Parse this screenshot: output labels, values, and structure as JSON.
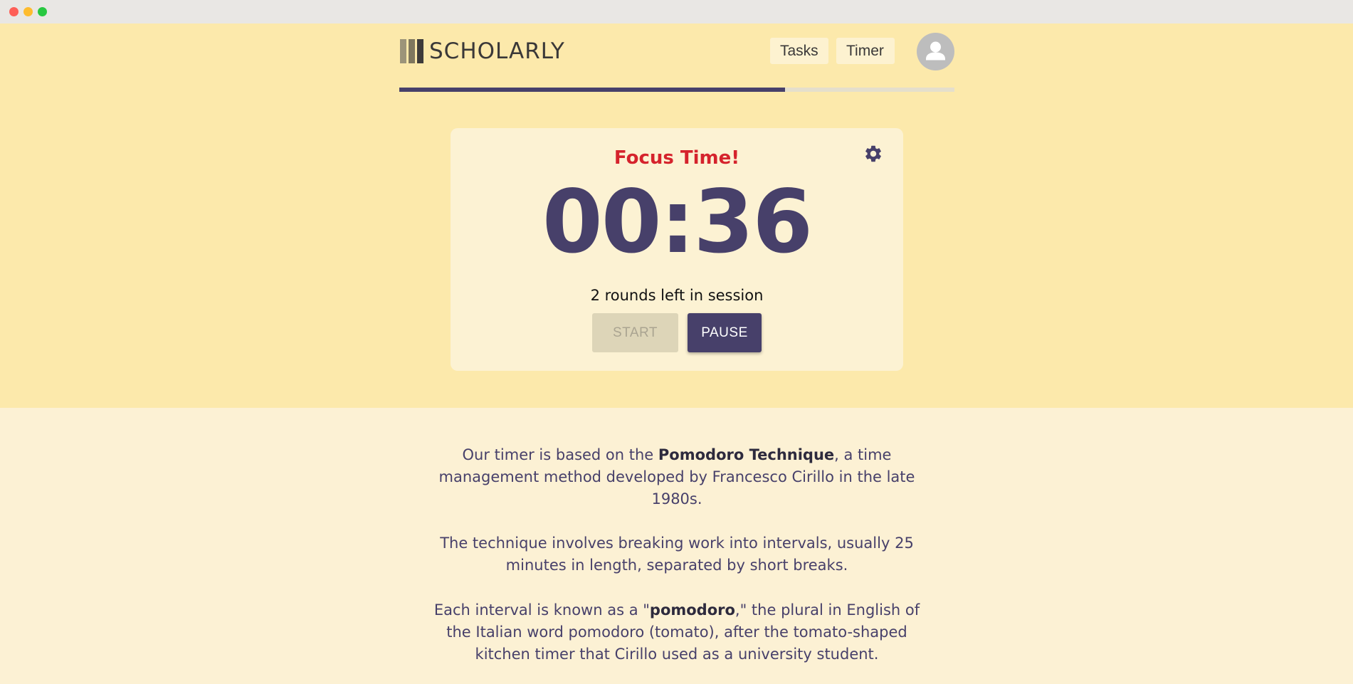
{
  "window": {
    "buttons": [
      "close",
      "minimize",
      "maximize"
    ]
  },
  "header": {
    "logo_text": "SCHOLARLY",
    "nav": {
      "tasks": "Tasks",
      "timer": "Timer"
    },
    "avatar_icon": "user-icon"
  },
  "progress": {
    "fraction": 0.695,
    "color": "#47406a"
  },
  "timer": {
    "status": "Focus Time!",
    "time": "00:36",
    "rounds_left": "2 rounds left in session",
    "start_label": "START",
    "pause_label": "PAUSE",
    "settings_icon": "gear-icon"
  },
  "about": {
    "p1": {
      "before": "Our timer is based on the ",
      "bold": "Pomodoro Technique",
      "after": ", a time management method developed by Francesco Cirillo in the late 1980s."
    },
    "p2": "The technique involves breaking work into intervals, usually 25 minutes in length, separated by short breaks.",
    "p3": {
      "before": "Each interval is known as a \"",
      "bold": "pomodoro",
      "after": ",\" the plural in English of the Italian word pomodoro (tomato), after the tomato-shaped kitchen timer that Cirillo used as a university student."
    }
  },
  "colors": {
    "accent": "#47406a",
    "focus": "#d5232c",
    "hero_bg": "#fce9ab",
    "page_bg": "#fcf1d4"
  }
}
